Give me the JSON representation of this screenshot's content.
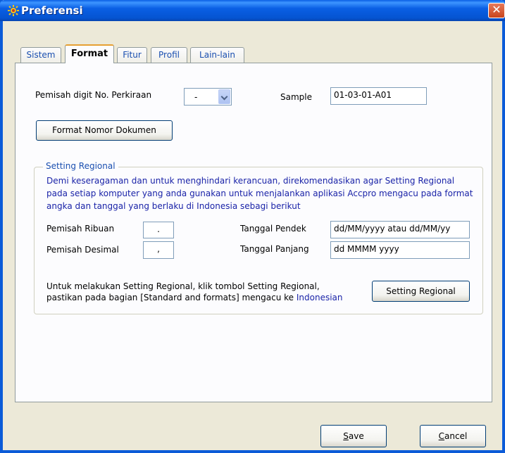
{
  "window": {
    "title": "Preferensi",
    "close_glyph": "✕"
  },
  "tabs": [
    {
      "label": "Sistem",
      "active": false
    },
    {
      "label": "Format",
      "active": true
    },
    {
      "label": "Fitur",
      "active": false
    },
    {
      "label": "Profil",
      "active": false
    },
    {
      "label": "Lain-lain",
      "active": false
    }
  ],
  "format": {
    "digit_separator_label": "Pemisah digit No. Perkiraan",
    "digit_separator_value": "-",
    "sample_label": "Sample",
    "sample_value": "01-03-01-A01",
    "format_doc_button": "Format Nomor Dokumen"
  },
  "regional": {
    "group_title": "Setting Regional",
    "note": "Demi keseragaman dan untuk menghindari kerancuan, direkomendasikan agar Setting Regional pada setiap komputer yang anda gunakan untuk menjalankan aplikasi Accpro mengacu pada format angka dan tanggal yang berlaku di Indonesia sebagi berikut",
    "thousand_label": "Pemisah Ribuan",
    "thousand_value": ".",
    "decimal_label": "Pemisah Desimal",
    "decimal_value": ",",
    "short_date_label": "Tanggal Pendek",
    "short_date_value": "dd/MM/yyyy atau dd/MM/yy",
    "long_date_label": "Tanggal Panjang",
    "long_date_value": "dd MMMM yyyy",
    "instruction_line1": "Untuk melakukan Setting Regional, klik tombol Setting Regional,",
    "instruction_line2_pre": "pastikan pada bagian [Standard and formats] mengacu ke ",
    "instruction_line2_highlight": "Indonesian",
    "setting_button": "Setting Regional"
  },
  "footer": {
    "save_mnemonic": "S",
    "save_rest": "ave",
    "cancel_mnemonic": "C",
    "cancel_rest": "ancel"
  },
  "colors": {
    "title_bar": "#0a5fe4",
    "link_blue": "#1a23a8",
    "tab_text": "#1a4fb0"
  }
}
